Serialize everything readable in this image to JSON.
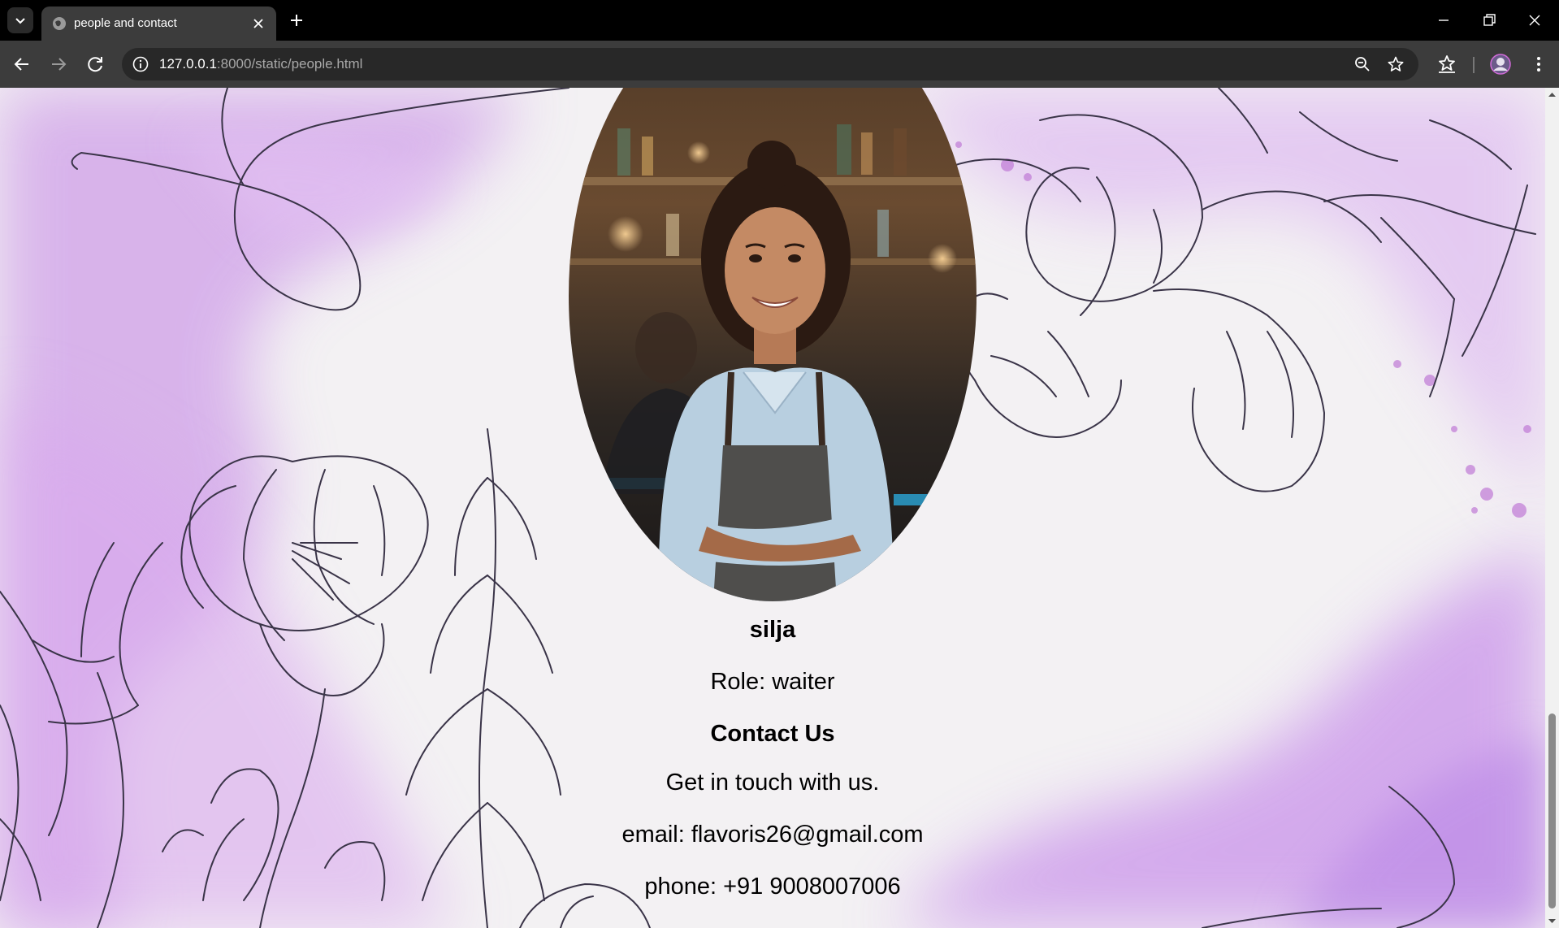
{
  "browser": {
    "tab_title": "people and contact",
    "url_host": "127.0.0.1",
    "url_rest": ":8000/static/people.html",
    "icons": {
      "tab_search": "chevron-down-icon",
      "favicon": "globe-icon",
      "tab_close": "close-icon",
      "new_tab": "plus-icon",
      "minimize": "minimize-icon",
      "restore": "restore-icon",
      "close_window": "close-icon",
      "back": "arrow-left-icon",
      "forward": "arrow-right-icon",
      "reload": "reload-icon",
      "site_info": "info-icon",
      "zoom": "zoom-out-icon",
      "bookmark": "star-icon",
      "bookmarks_menu": "star-list-icon",
      "profile": "avatar-icon",
      "menu": "kebab-menu-icon"
    }
  },
  "page": {
    "person": {
      "name": "silja",
      "role_line": "Role: waiter"
    },
    "contact": {
      "heading": "Contact Us",
      "subtitle": "Get in touch with us.",
      "email_line": "email: flavoris26@gmail.com",
      "phone_line": "phone: +91 9008007006"
    },
    "colors": {
      "background": "#f3f1f3",
      "wash": "#c99be6",
      "line_art": "#3a3448",
      "text": "#000000"
    }
  }
}
